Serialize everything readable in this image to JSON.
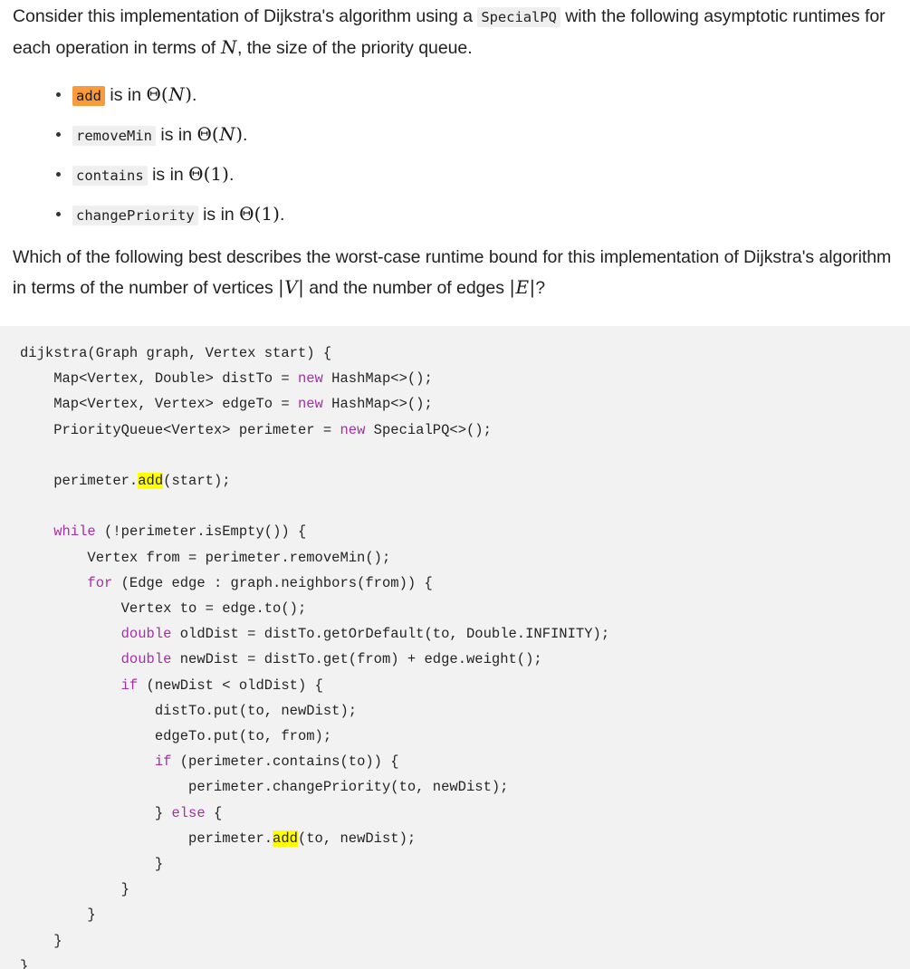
{
  "document": {
    "intro_paragraph": {
      "part1": "Consider this implementation of Dijkstra's algorithm using a ",
      "inline_code": "SpecialPQ",
      "part2": " with the following asymptotic runtimes for each operation in terms of ",
      "math_var": "N",
      "part3": ", the size of the priority queue."
    },
    "operations": [
      {
        "name": "add",
        "highlight": "orange",
        "text_before": " is in ",
        "complexity_symbol": "Θ",
        "complexity_arg": "N",
        "arg_italic": true,
        "suffix": "."
      },
      {
        "name": "removeMin",
        "highlight": "none",
        "text_before": " is in ",
        "complexity_symbol": "Θ",
        "complexity_arg": "N",
        "arg_italic": true,
        "suffix": "."
      },
      {
        "name": "contains",
        "highlight": "none",
        "text_before": " is in ",
        "complexity_symbol": "Θ",
        "complexity_arg": "1",
        "arg_italic": false,
        "suffix": "."
      },
      {
        "name": "changePriority",
        "highlight": "none",
        "text_before": " is in ",
        "complexity_symbol": "Θ",
        "complexity_arg": "1",
        "arg_italic": false,
        "suffix": "."
      }
    ],
    "question_paragraph": {
      "part1": "Which of the following best describes the worst-case runtime bound for this implementation of Dijkstra's algorithm in terms of the number of vertices ",
      "math_vertices": "|V|",
      "part2": " and the number of edges ",
      "math_edges": "|E|",
      "part3": "?"
    },
    "code_block": {
      "language": "java",
      "lines": [
        [
          {
            "t": "dijkstra(Graph graph, Vertex start) {",
            "s": "plain"
          }
        ],
        [
          {
            "t": "    Map<Vertex, Double> distTo = ",
            "s": "plain"
          },
          {
            "t": "new",
            "s": "kw"
          },
          {
            "t": " HashMap<>();",
            "s": "plain"
          }
        ],
        [
          {
            "t": "    Map<Vertex, Vertex> edgeTo = ",
            "s": "plain"
          },
          {
            "t": "new",
            "s": "kw"
          },
          {
            "t": " HashMap<>();",
            "s": "plain"
          }
        ],
        [
          {
            "t": "    PriorityQueue<Vertex> perimeter = ",
            "s": "plain"
          },
          {
            "t": "new",
            "s": "kw"
          },
          {
            "t": " SpecialPQ<>();",
            "s": "plain"
          }
        ],
        [
          {
            "t": "",
            "s": "plain"
          }
        ],
        [
          {
            "t": "    perimeter.",
            "s": "plain"
          },
          {
            "t": "add",
            "s": "hl"
          },
          {
            "t": "(start);",
            "s": "plain"
          }
        ],
        [
          {
            "t": "",
            "s": "plain"
          }
        ],
        [
          {
            "t": "    ",
            "s": "plain"
          },
          {
            "t": "while",
            "s": "kw"
          },
          {
            "t": " (!perimeter.isEmpty()) {",
            "s": "plain"
          }
        ],
        [
          {
            "t": "        Vertex from = perimeter.removeMin();",
            "s": "plain"
          }
        ],
        [
          {
            "t": "        ",
            "s": "plain"
          },
          {
            "t": "for",
            "s": "kw"
          },
          {
            "t": " (Edge edge : graph.neighbors(from)) {",
            "s": "plain"
          }
        ],
        [
          {
            "t": "            Vertex to = edge.to();",
            "s": "plain"
          }
        ],
        [
          {
            "t": "            ",
            "s": "plain"
          },
          {
            "t": "double",
            "s": "kw"
          },
          {
            "t": " oldDist = distTo.getOrDefault(to, Double.INFINITY);",
            "s": "plain"
          }
        ],
        [
          {
            "t": "            ",
            "s": "plain"
          },
          {
            "t": "double",
            "s": "kw"
          },
          {
            "t": " newDist = distTo.get(from) + edge.weight();",
            "s": "plain"
          }
        ],
        [
          {
            "t": "            ",
            "s": "plain"
          },
          {
            "t": "if",
            "s": "kw"
          },
          {
            "t": " (newDist < oldDist) {",
            "s": "plain"
          }
        ],
        [
          {
            "t": "                distTo.put(to, newDist);",
            "s": "plain"
          }
        ],
        [
          {
            "t": "                edgeTo.put(to, from);",
            "s": "plain"
          }
        ],
        [
          {
            "t": "                ",
            "s": "plain"
          },
          {
            "t": "if",
            "s": "kw"
          },
          {
            "t": " (perimeter.contains(to)) {",
            "s": "plain"
          }
        ],
        [
          {
            "t": "                    perimeter.changePriority(to, newDist);",
            "s": "plain"
          }
        ],
        [
          {
            "t": "                } ",
            "s": "plain"
          },
          {
            "t": "else",
            "s": "kw"
          },
          {
            "t": " {",
            "s": "plain"
          }
        ],
        [
          {
            "t": "                    perimeter.",
            "s": "plain"
          },
          {
            "t": "add",
            "s": "hl"
          },
          {
            "t": "(to, newDist);",
            "s": "plain"
          }
        ],
        [
          {
            "t": "                }",
            "s": "plain"
          }
        ],
        [
          {
            "t": "            }",
            "s": "plain"
          }
        ],
        [
          {
            "t": "        }",
            "s": "plain"
          }
        ],
        [
          {
            "t": "    }",
            "s": "plain"
          }
        ],
        [
          {
            "t": "}",
            "s": "plain"
          }
        ]
      ]
    },
    "colors": {
      "page_background": "#ffffff",
      "text": "#222222",
      "code_background": "#f2f2f2",
      "inline_code_background": "#efefef",
      "keyword": "#a331a3",
      "highlight_orange": "#f89b3c",
      "highlight_yellow": "#ffff00"
    }
  }
}
